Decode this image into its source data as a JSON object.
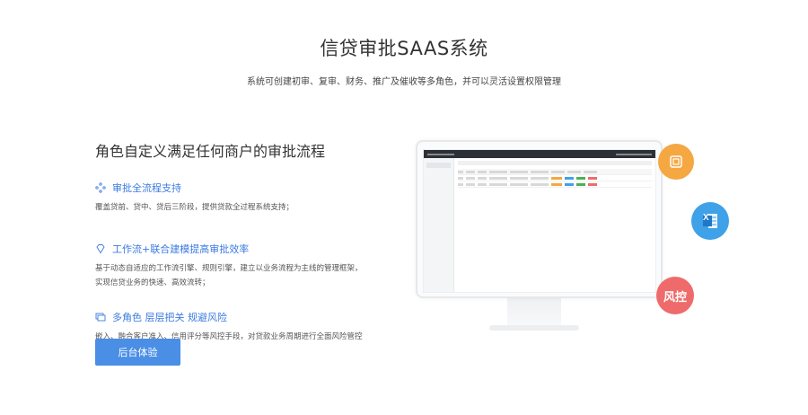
{
  "header": {
    "title": "信贷审批SAAS系统",
    "subtitle": "系统可创建初审、复审、财务、推广及催收等多角色，并可以灵活设置权限管理"
  },
  "section": {
    "heading": "角色自定义满足任何商户的审批流程",
    "features": [
      {
        "icon": "process-icon",
        "title": "审批全流程支持",
        "desc": "覆盖贷前、贷中、贷后三阶段，提供贷款全过程系统支持；"
      },
      {
        "icon": "diamond-icon",
        "title": "工作流+联合建模提高审批效率",
        "desc": "基于动态自适应的工作流引擎、规则引擎，建立以业务流程为主线的管理框架，实现信贷业务的快速、高效流转；"
      },
      {
        "icon": "layers-icon",
        "title": "多角色 层层把关 规避风险",
        "desc": "嵌入、融合客户准入、信用评分等风控手段，对贷款业务周期进行全面风险管控和智能决策分析。"
      }
    ],
    "cta_label": "后台体验"
  },
  "badges": {
    "risk_label": "风控",
    "excel_letter": "X"
  },
  "colors": {
    "accent": "#4a8ee6",
    "orange": "#f5a742",
    "blue": "#3fa1e8",
    "red": "#ef6b6b"
  }
}
